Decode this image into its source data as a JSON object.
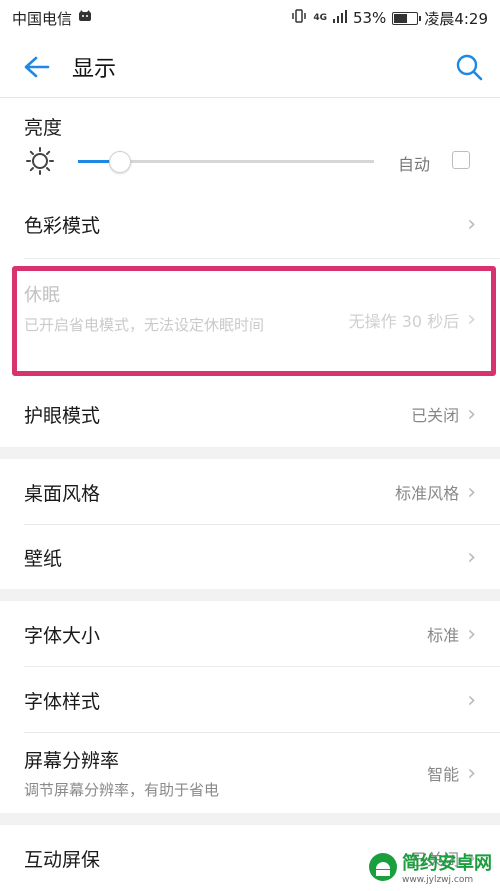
{
  "status": {
    "carrier": "中国电信",
    "signal": "4G",
    "battery": "53%",
    "time": "凌晨4:29",
    "battery_level": 0.53
  },
  "header": {
    "title": "显示"
  },
  "brightness": {
    "label": "亮度",
    "auto_label": "自动",
    "level": 0.14,
    "auto_checked": false
  },
  "rows": {
    "color_mode": {
      "label": "色彩模式"
    },
    "sleep": {
      "label": "休眠",
      "description": "已开启省电模式，无法设定休眠时间",
      "value": "无操作 30 秒后"
    },
    "eye_care": {
      "label": "护眼模式",
      "value": "已关闭"
    },
    "desktop_style": {
      "label": "桌面风格",
      "value": "标准风格"
    },
    "wallpaper": {
      "label": "壁纸"
    },
    "font_size": {
      "label": "字体大小",
      "value": "标准"
    },
    "font_style": {
      "label": "字体样式"
    },
    "resolution": {
      "label": "屏幕分辨率",
      "description": "调节屏幕分辨率，有助于省电",
      "value": "智能"
    },
    "screensaver": {
      "label": "互动屏保",
      "value": "已关闭"
    }
  },
  "watermark": {
    "text": "简约安卓网",
    "url": "www.jylzwj.com"
  },
  "colors": {
    "accent": "#1e88e5",
    "highlight": "#d8336f"
  }
}
